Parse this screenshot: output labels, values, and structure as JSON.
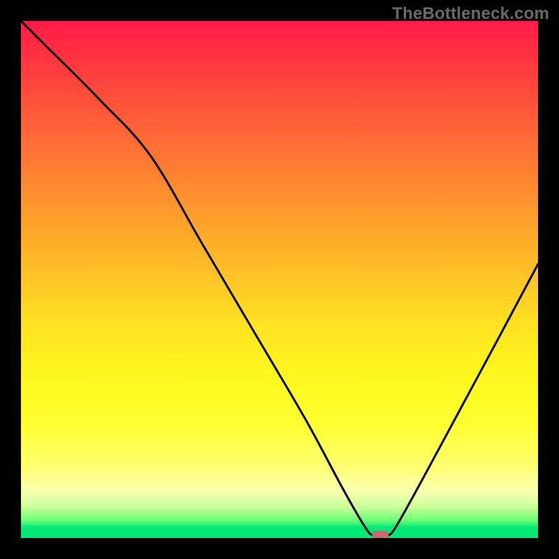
{
  "watermark": "TheBottleneck.com",
  "chart_data": {
    "type": "line",
    "title": "",
    "xlabel": "",
    "ylabel": "",
    "xlim": [
      0,
      100
    ],
    "ylim": [
      0,
      100
    ],
    "grid": false,
    "legend": false,
    "series": [
      {
        "name": "bottleneck-curve",
        "x": [
          0,
          5,
          15,
          25,
          35,
          45,
          55,
          62,
          66,
          68,
          71,
          73,
          78,
          85,
          92,
          100
        ],
        "y": [
          100,
          95,
          85,
          74,
          57,
          40,
          23,
          10,
          3,
          0.5,
          0.5,
          3,
          12,
          25,
          38,
          53
        ]
      }
    ],
    "marker": {
      "name": "optimal-point",
      "x": 69.5,
      "y": 0.6,
      "width_pct": 3.2,
      "height_pct": 1.6,
      "color": "#c96b6b"
    },
    "background_gradient": {
      "stops": [
        {
          "pos": 0.0,
          "color": "#ff1a49"
        },
        {
          "pos": 0.18,
          "color": "#ff5a3a"
        },
        {
          "pos": 0.46,
          "color": "#ffb828"
        },
        {
          "pos": 0.68,
          "color": "#fff61e"
        },
        {
          "pos": 0.91,
          "color": "#f8ffb0"
        },
        {
          "pos": 0.98,
          "color": "#00e976"
        }
      ]
    }
  }
}
